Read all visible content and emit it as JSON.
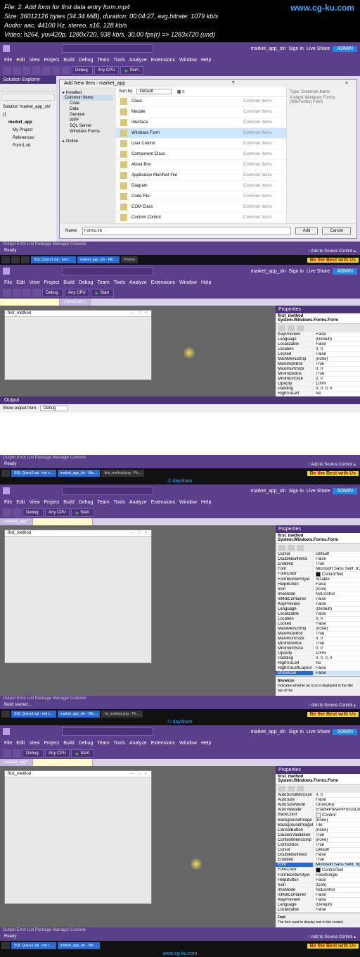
{
  "header": {
    "file": "File: 2. Add form for first data entry form.mp4",
    "size": "Size: 36012126 bytes (34.34 MiB), duration: 00:04:27, avg.bitrate: 1079 kb/s",
    "audio": "Audio: aac, 44100 Hz, stereo, s16, 128 kb/s",
    "video": "Video: h264, yuv420p, 1280x720, 938 kb/s, 30.00 fps(r) => 1283x720 (und)",
    "watermark": "www.cg-ku.com"
  },
  "vs": {
    "menu": [
      "File",
      "Edit",
      "View",
      "Project",
      "Build",
      "Debug",
      "Team",
      "Tools",
      "Analyze",
      "Extensions",
      "Window",
      "Help"
    ],
    "debug": "Debug",
    "anycpu": "Any CPU",
    "start": "Start",
    "signin": "Sign in",
    "liveshare": "Live Share",
    "admin": "ADMIN",
    "proj": "market_app_sln",
    "ready": "Ready",
    "addsrc": "↑ Add to Source Control ▴",
    "outtabs": "Output   Error List   Package Manager Console"
  },
  "sol": {
    "title": "Solution Explorer",
    "search_ph": "Search Solution Explorer (Ctrl+;)",
    "root": "Solution 'market_app_sln' (1",
    "items": [
      "market_app",
      "My Project",
      "References",
      "Form1.vb"
    ]
  },
  "dlg": {
    "title": "Add New Item - market_app",
    "installed": "▸ Installed",
    "common": "Common Items",
    "sub": [
      "Code",
      "Data",
      "General",
      "WPF",
      "SQL Server",
      "Windows Forms"
    ],
    "online": "▸ Online",
    "sortby": "Sort by:",
    "sortval": "Default",
    "cat": "Common Items",
    "rows": [
      "Class",
      "Module",
      "Interface",
      "Windows Form",
      "User Control",
      "Component Class",
      "About Box",
      "Application Manifest File",
      "Diagram",
      "Code File",
      "COM Class",
      "Custom Control"
    ],
    "typehdr": "Type:",
    "typeval": "Common Items",
    "typedesc": "A blank Windows Forms (WinForms) Form",
    "namelbl": "Name:",
    "nameval": "Form2.vb",
    "add": "Add",
    "cancel": "Cancel"
  },
  "props2": {
    "title": "Properties",
    "obj": "first_method  System.Windows.Forms.Form",
    "rows": [
      [
        "KeyPreview",
        "False"
      ],
      [
        "Language",
        "(Default)"
      ],
      [
        "Localizable",
        "False"
      ],
      [
        "Location",
        "0, 0"
      ],
      [
        "Locked",
        "False"
      ],
      [
        "MainMenuStrip",
        "(none)"
      ],
      [
        "MaximizeBox",
        "True"
      ],
      [
        "MaximumSize",
        "0, 0"
      ],
      [
        "MinimizeBox",
        "True"
      ],
      [
        "MinimumSize",
        "0, 0"
      ],
      [
        "Opacity",
        "100%"
      ],
      [
        "Padding",
        "0, 0, 0, 0"
      ],
      [
        "RightToLeft",
        "No"
      ]
    ]
  },
  "props3": {
    "rows": [
      [
        "Cursor",
        "Default"
      ],
      [
        "DoubleBuffered",
        "False"
      ],
      [
        "Enabled",
        "True"
      ],
      [
        "Font",
        "Microsoft Sans Serif, 8.25pt"
      ],
      [
        "ForeColor",
        "ControlText"
      ],
      [
        "FormBorderStyle",
        "Sizable"
      ],
      [
        "HelpButton",
        "False"
      ],
      [
        "Icon",
        "(Icon)"
      ],
      [
        "ImeMode",
        "NoControl"
      ],
      [
        "IsMdiContainer",
        "False"
      ],
      [
        "KeyPreview",
        "False"
      ],
      [
        "Language",
        "(Default)"
      ],
      [
        "Localizable",
        "False"
      ],
      [
        "Location",
        "0, 0"
      ],
      [
        "Locked",
        "False"
      ],
      [
        "MainMenuStrip",
        "(none)"
      ],
      [
        "MaximizeBox",
        "True"
      ],
      [
        "MaximumSize",
        "0, 0"
      ],
      [
        "MinimizeBox",
        "True"
      ],
      [
        "MinimumSize",
        "0, 0"
      ],
      [
        "Opacity",
        "100%"
      ],
      [
        "Padding",
        "0, 0, 0, 0"
      ],
      [
        "RightToLeft",
        "No"
      ],
      [
        "RightToLeftLayout",
        "False"
      ],
      [
        "ShowIcon",
        "False"
      ]
    ],
    "selidx": 24,
    "desc_t": "ShowIcon",
    "desc": "Indicates whether an icon is displayed in the title bar of the"
  },
  "props4": {
    "rows": [
      [
        "AutoScrollMinSize",
        "0, 0"
      ],
      [
        "AutoSize",
        "False"
      ],
      [
        "AutoSizeMode",
        "GrowOnly"
      ],
      [
        "AutoValidate",
        "EnablePreventFocusChange"
      ],
      [
        "BackColor",
        "Control"
      ],
      [
        "BackgroundImage",
        "(none)"
      ],
      [
        "BackgroundImageLayout",
        "Tile"
      ],
      [
        "CancelButton",
        "(none)"
      ],
      [
        "CausesValidation",
        "True"
      ],
      [
        "ContextMenuStrip",
        "(none)"
      ],
      [
        "ControlBox",
        "True"
      ],
      [
        "Cursor",
        "Default"
      ],
      [
        "DoubleBuffered",
        "False"
      ],
      [
        "Enabled",
        "True"
      ],
      [
        "Font",
        "Microsoft Sans Serif, 9pt…"
      ],
      [
        "ForeColor",
        "ControlText"
      ],
      [
        "FormBorderStyle",
        "FixedSingle"
      ],
      [
        "HelpButton",
        "False"
      ],
      [
        "Icon",
        "(Icon)"
      ],
      [
        "ImeMode",
        "NoControl"
      ],
      [
        "IsMdiContainer",
        "False"
      ],
      [
        "KeyPreview",
        "False"
      ],
      [
        "Language",
        "(Default)"
      ],
      [
        "Localizable",
        "False"
      ]
    ],
    "selidx": 14,
    "desc_t": "Font",
    "desc": "The font used to display text in the control."
  },
  "tabs": {
    "market": "market_app*",
    "fm": "first_method.vb [Design]*"
  },
  "out": {
    "title": "Output",
    "show": "Show output from:",
    "val": "Debug"
  },
  "form": {
    "title": "first_method"
  },
  "tb": {
    "sql": "SQL Query1.sql - not c…",
    "mkt": "market_app_sln - Mic…",
    "photos": "Photos",
    "best": "Be the Best with Us",
    "vd": "vd_method.png - Ph…",
    "fm": "first_method.png - Ph…",
    "dd": "© daydown"
  }
}
